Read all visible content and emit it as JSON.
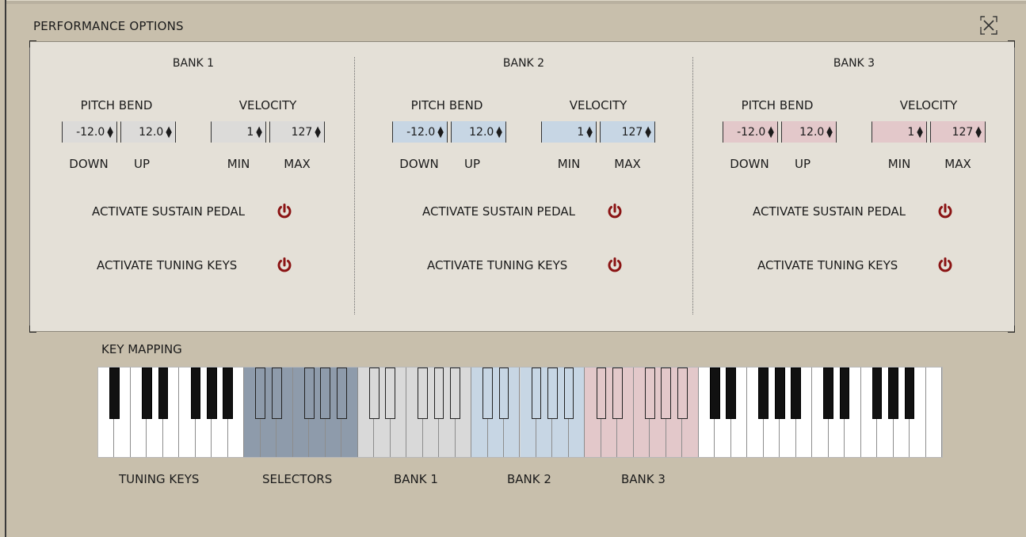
{
  "window": {
    "title": "PERFORMANCE OPTIONS",
    "close_icon": "close-icon"
  },
  "banks": [
    {
      "title": "BANK 1",
      "pitch_bend": {
        "label": "PITCH BEND",
        "down": "-12.0",
        "up": "12.0",
        "down_label": "DOWN",
        "up_label": "UP"
      },
      "velocity": {
        "label": "VELOCITY",
        "min": "1",
        "max": "127",
        "min_label": "MIN",
        "max_label": "MAX"
      },
      "sustain_label": "ACTIVATE SUSTAIN PEDAL",
      "tuning_label": "ACTIVATE TUNING KEYS",
      "color": "gray"
    },
    {
      "title": "BANK 2",
      "pitch_bend": {
        "label": "PITCH BEND",
        "down": "-12.0",
        "up": "12.0",
        "down_label": "DOWN",
        "up_label": "UP"
      },
      "velocity": {
        "label": "VELOCITY",
        "min": "1",
        "max": "127",
        "min_label": "MIN",
        "max_label": "MAX"
      },
      "sustain_label": "ACTIVATE SUSTAIN PEDAL",
      "tuning_label": "ACTIVATE TUNING KEYS",
      "color": "blue"
    },
    {
      "title": "BANK 3",
      "pitch_bend": {
        "label": "PITCH BEND",
        "down": "-12.0",
        "up": "12.0",
        "down_label": "DOWN",
        "up_label": "UP"
      },
      "velocity": {
        "label": "VELOCITY",
        "min": "1",
        "max": "127",
        "min_label": "MIN",
        "max_label": "MAX"
      },
      "sustain_label": "ACTIVATE SUSTAIN PEDAL",
      "tuning_label": "ACTIVATE TUNING KEYS",
      "color": "pink"
    }
  ],
  "spin_arrows": "▲▼",
  "key_mapping": {
    "title": "KEY MAPPING",
    "zones": [
      "TUNING KEYS",
      "SELECTORS",
      "BANK 1",
      "BANK 2",
      "BANK 3"
    ]
  },
  "colors": {
    "background": "#c8bfac",
    "panel": "#e4e0d7",
    "power_accent": "#8b1414",
    "selectors": "#8e9bab",
    "bank1": "#d9d9d9",
    "bank2": "#c7d6e4",
    "bank3": "#e3c8ca"
  }
}
